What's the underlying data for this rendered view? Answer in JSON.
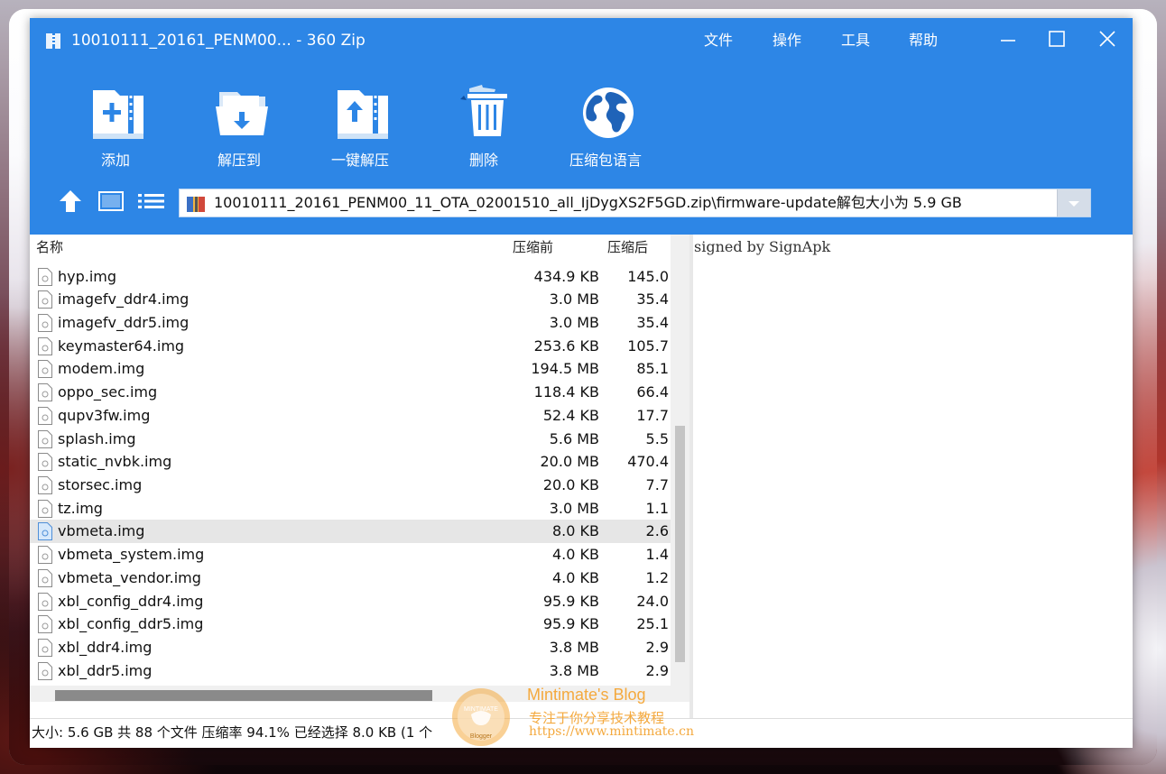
{
  "window": {
    "title": "10010111_20161_PENM00... - 360 Zip",
    "menu": [
      "文件",
      "操作",
      "工具",
      "帮助"
    ]
  },
  "toolbar": [
    {
      "label": "添加",
      "icon": "add-icon"
    },
    {
      "label": "解压到",
      "icon": "extract-to-icon"
    },
    {
      "label": "一键解压",
      "icon": "one-click-extract-icon"
    },
    {
      "label": "删除",
      "icon": "delete-icon"
    },
    {
      "label": "压缩包语言",
      "icon": "globe-icon"
    }
  ],
  "pathbar": {
    "path": "10010111_20161_PENM00_11_OTA_02001510_all_IjDygXS2F5GD.zip\\firmware-update解包大小为 5.9 GB"
  },
  "columns": {
    "name": "名称",
    "before": "压缩前",
    "after": "压缩后"
  },
  "files": [
    {
      "name": "hyp.img",
      "before": "434.9 KB",
      "after": "145.0"
    },
    {
      "name": "imagefv_ddr4.img",
      "before": "3.0 MB",
      "after": "35.4"
    },
    {
      "name": "imagefv_ddr5.img",
      "before": "3.0 MB",
      "after": "35.4"
    },
    {
      "name": "keymaster64.img",
      "before": "253.6 KB",
      "after": "105.7"
    },
    {
      "name": "modem.img",
      "before": "194.5 MB",
      "after": "85.1"
    },
    {
      "name": "oppo_sec.img",
      "before": "118.4 KB",
      "after": "66.4"
    },
    {
      "name": "qupv3fw.img",
      "before": "52.4 KB",
      "after": "17.7"
    },
    {
      "name": "splash.img",
      "before": "5.6 MB",
      "after": "5.5"
    },
    {
      "name": "static_nvbk.img",
      "before": "20.0 MB",
      "after": "470.4"
    },
    {
      "name": "storsec.img",
      "before": "20.0 KB",
      "after": "7.7"
    },
    {
      "name": "tz.img",
      "before": "3.0 MB",
      "after": "1.1"
    },
    {
      "name": "vbmeta.img",
      "before": "8.0 KB",
      "after": "2.6"
    },
    {
      "name": "vbmeta_system.img",
      "before": "4.0 KB",
      "after": "1.4"
    },
    {
      "name": "vbmeta_vendor.img",
      "before": "4.0 KB",
      "after": "1.2"
    },
    {
      "name": "xbl_config_ddr4.img",
      "before": "95.9 KB",
      "after": "24.0"
    },
    {
      "name": "xbl_config_ddr5.img",
      "before": "95.9 KB",
      "after": "25.1"
    },
    {
      "name": "xbl_ddr4.img",
      "before": "3.8 MB",
      "after": "2.9"
    },
    {
      "name": "xbl_ddr5.img",
      "before": "3.8 MB",
      "after": "2.9"
    }
  ],
  "selected_file": "vbmeta.img",
  "preview": {
    "text": "signed by SignApk"
  },
  "statusbar": {
    "text": "大小: 5.6 GB 共 88 个文件 压缩率 94.1% 已经选择 8.0 KB (1 个"
  },
  "watermark": {
    "title": "Mintimate's Blog",
    "subtitle": "专注于你分享技术教程",
    "url": "https://www.mintimate.cn",
    "logo_text": "MINTIMATE",
    "logo_sub": "Blogger"
  },
  "colors": {
    "header": "#2d86e6",
    "selected_row": "#e6e6e6",
    "watermark": "#f4a93e"
  }
}
